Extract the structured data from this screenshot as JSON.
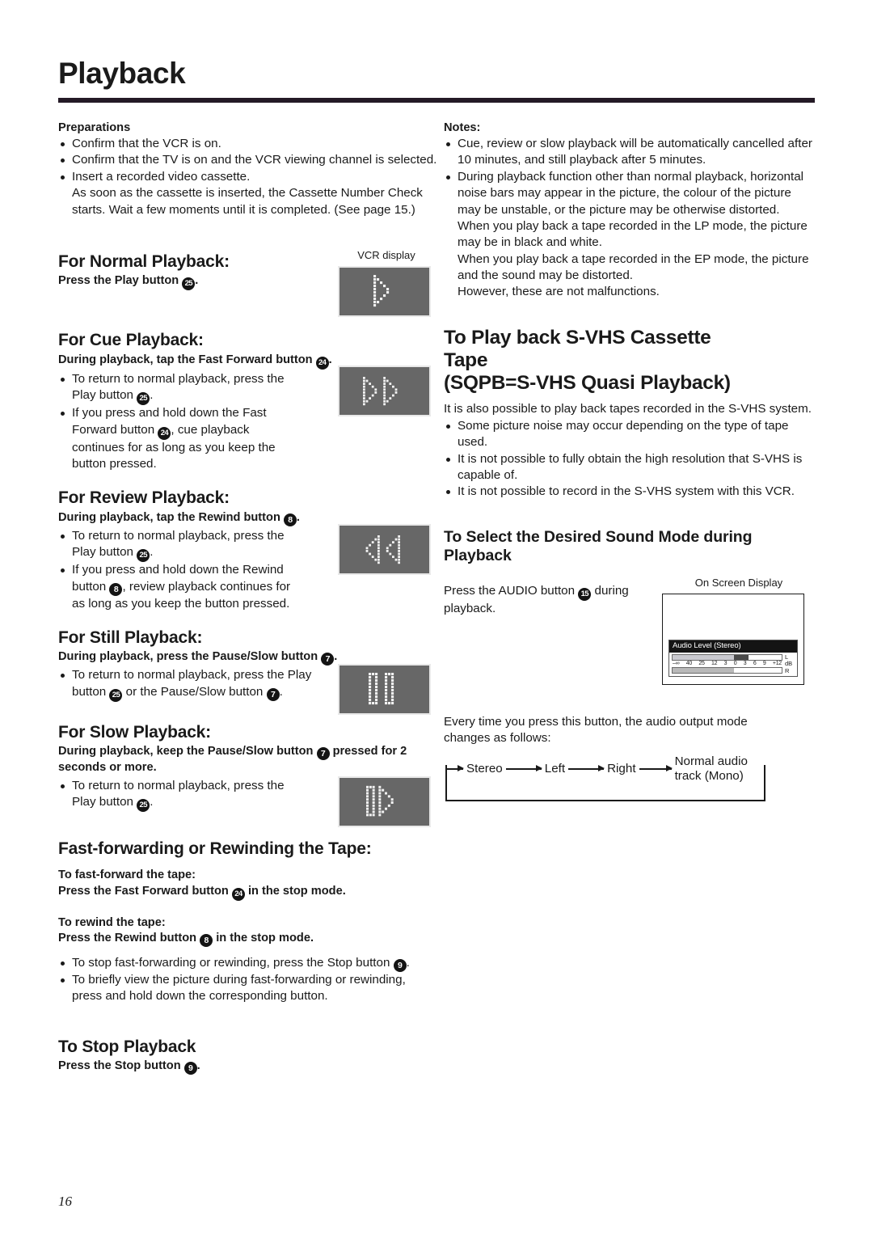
{
  "page": {
    "title": "Playback",
    "number": "16"
  },
  "preparations": {
    "heading": "Preparations",
    "items": [
      "Confirm that the VCR is on.",
      "Confirm that the TV is on and the VCR viewing channel is selected.",
      "Insert a recorded video cassette."
    ],
    "note": "As soon as the cassette is inserted, the Cassette Number Check starts. Wait a few moments until it is completed. (See page 15.)"
  },
  "notes": {
    "heading": "Notes:",
    "items": [
      "Cue, review or slow playback will be automatically cancelled after 10 minutes, and still playback after 5 minutes.",
      "During playback function other than normal playback, horizontal noise bars may appear in the picture, the colour of the picture may be unstable, or the picture may be otherwise distorted."
    ],
    "extra": [
      "When you play back a tape recorded in the LP mode, the picture may be in black and white.",
      "When you play back a tape recorded in the EP mode, the picture and the sound may be distorted.",
      "However, these are not malfunctions."
    ]
  },
  "vcr_display_label": "VCR display",
  "sections": {
    "normal": {
      "heading": "For Normal Playback:",
      "instruction_pre": "Press the Play button ",
      "instruction_ref": "25",
      "instruction_post": ".",
      "display_icon": "play-icon"
    },
    "cue": {
      "heading": "For Cue Playback:",
      "instruction_pre": "During playback, tap the Fast Forward button ",
      "instruction_ref": "24",
      "instruction_post": ".",
      "bullets": [
        {
          "pre": "To return to normal playback, press the Play button ",
          "ref": "25",
          "post": "."
        },
        {
          "pre": "If you press and hold down the Fast Forward button ",
          "ref": "24",
          "post": ", cue playback continues for as long as you keep the button pressed."
        }
      ],
      "display_icon": "fast-forward-icon"
    },
    "review": {
      "heading": "For Review Playback:",
      "instruction_pre": "During playback, tap the Rewind button ",
      "instruction_ref": "8",
      "instruction_post": ".",
      "bullets": [
        {
          "pre": "To return to normal playback, press the Play button ",
          "ref": "25",
          "post": "."
        },
        {
          "pre": "If you press and hold down the Rewind button ",
          "ref": "8",
          "post": ", review playback continues for as long as you keep the button pressed."
        }
      ],
      "display_icon": "rewind-icon"
    },
    "still": {
      "heading": "For Still Playback:",
      "instruction_pre": "During playback, press the Pause/Slow button ",
      "instruction_ref": "7",
      "instruction_post": ".",
      "bullet_pre": "To return to normal playback, press the Play button ",
      "bullet_ref1": "25",
      "bullet_mid": " or the Pause/Slow button ",
      "bullet_ref2": "7",
      "bullet_post": ".",
      "display_icon": "pause-icon"
    },
    "slow": {
      "heading": "For Slow Playback:",
      "instruction_pre": "During playback, keep the Pause/Slow button ",
      "instruction_ref": "7",
      "instruction_post": " pressed for 2 seconds or more.",
      "bullet_pre": "To return to normal playback, press the Play button ",
      "bullet_ref": "25",
      "bullet_post": ".",
      "display_icon": "slow-play-icon"
    },
    "ffrew": {
      "heading": "Fast-forwarding or Rewinding the Tape:",
      "ff_label": "To fast-forward the tape:",
      "ff_pre": "Press the Fast Forward button ",
      "ff_ref": "24",
      "ff_post": " in the stop mode.",
      "rew_label": "To rewind the tape:",
      "rew_pre": "Press the Rewind button ",
      "rew_ref": "8",
      "rew_post": " in the stop mode.",
      "bullets": [
        {
          "pre": "To stop fast-forwarding or rewinding, press the Stop button ",
          "ref": "9",
          "post": "."
        },
        {
          "pre": "To briefly view the picture during fast-forwarding or rewinding, press and hold down the corresponding button.",
          "ref": "",
          "post": ""
        }
      ]
    },
    "stop": {
      "heading": "To Stop Playback",
      "instruction_pre": "Press the Stop button ",
      "instruction_ref": "9",
      "instruction_post": "."
    },
    "svhs": {
      "heading_line1": "To Play back S-VHS Cassette",
      "heading_line2": "Tape",
      "heading_line3": "(SQPB=S-VHS Quasi Playback)",
      "intro": "It is also possible to play back tapes recorded in the S-VHS system.",
      "bullets": [
        "Some picture noise may occur depending on the type of tape used.",
        "It is not possible to fully obtain the high resolution that S-VHS is capable of.",
        "It is not possible to record in the S-VHS system with this VCR."
      ]
    },
    "sound": {
      "heading_line1": "To Select the Desired Sound Mode during",
      "heading_line2": "Playback",
      "instruction_pre": "Press the AUDIO button ",
      "instruction_ref": "15",
      "instruction_post": " during playback.",
      "osd_label": "On Screen Display",
      "osd": {
        "title": "Audio Level (Stereo)",
        "scale": [
          "–∞",
          "40",
          "25",
          "12",
          "3",
          "0",
          "3",
          "6",
          "9",
          "+12"
        ],
        "left_label": "L",
        "unit_label": "dB",
        "right_label": "R"
      },
      "cycle_intro": "Every time you press this button, the audio output mode changes as follows:",
      "cycle": [
        "Stereo",
        "Left",
        "Right",
        "Normal audio track (Mono)"
      ]
    }
  },
  "colors": {
    "rule": "#241a26",
    "display_bg": "#676767",
    "osd_title_bg": "#141414"
  }
}
